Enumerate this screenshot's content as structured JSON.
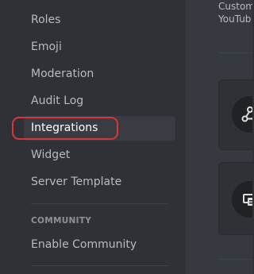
{
  "sidebar": {
    "items": [
      {
        "label": "Roles"
      },
      {
        "label": "Emoji"
      },
      {
        "label": "Moderation"
      },
      {
        "label": "Audit Log"
      },
      {
        "label": "Integrations",
        "selected": true
      },
      {
        "label": "Widget"
      },
      {
        "label": "Server Template"
      }
    ],
    "community_section": {
      "header": "COMMUNITY",
      "items": [
        {
          "label": "Enable Community"
        }
      ]
    }
  },
  "content": {
    "description_lines": [
      "Custom",
      "YouTub"
    ],
    "cards": [
      {
        "icon": "webhook-icon"
      },
      {
        "icon": "server-icon"
      }
    ]
  },
  "colors": {
    "highlight_outline": "#d7363b",
    "sidebar_bg": "#2f3136",
    "content_bg": "#36393f",
    "selected_item_bg": "#393c43"
  }
}
